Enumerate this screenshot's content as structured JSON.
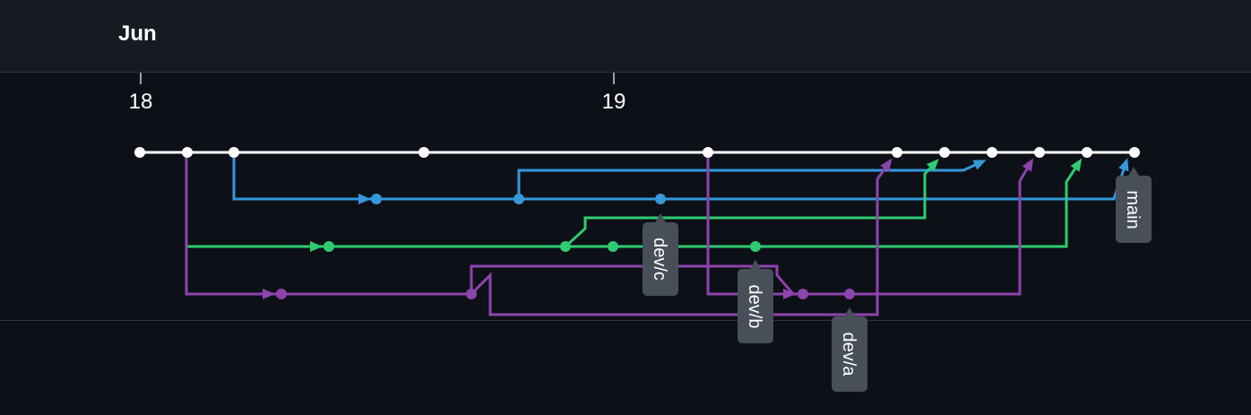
{
  "timeline": {
    "month": "Jun",
    "days": [
      "18",
      "19"
    ]
  },
  "colors": {
    "main": "#ffffff",
    "dev_a": "#8e44ad",
    "dev_b": "#2ecc71",
    "dev_c": "#3498db",
    "tag_bg": "#484f58",
    "header_bg": "#161b22",
    "body_bg": "#0d1117"
  },
  "branches": {
    "main": "main",
    "dev_a": "dev/a",
    "dev_b": "dev/b",
    "dev_c": "dev/c"
  }
}
